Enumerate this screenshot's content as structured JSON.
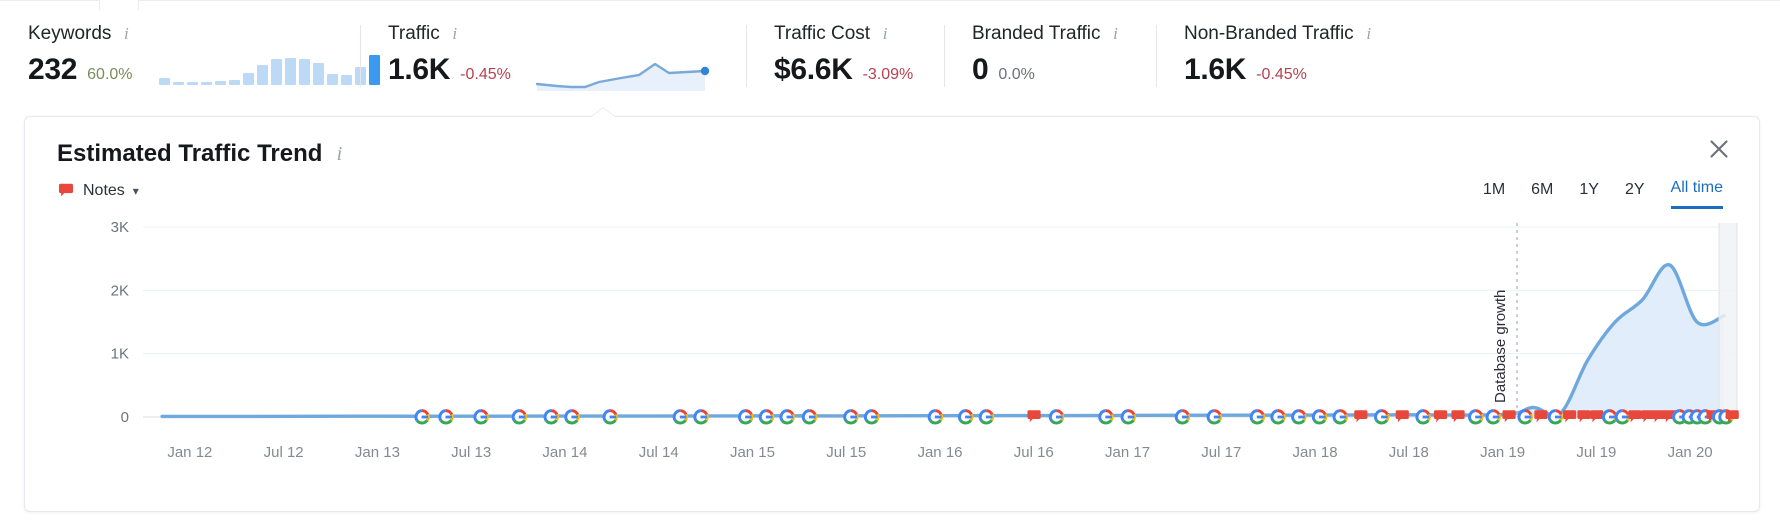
{
  "metrics": [
    {
      "label": "Keywords",
      "value": "232",
      "delta": "60.0%",
      "delta_kind": "pos",
      "info_icon": "info-icon",
      "sparkbars": [
        5,
        2,
        2,
        2,
        3,
        4,
        9,
        15,
        19,
        20,
        19,
        16,
        8,
        7,
        13,
        22
      ]
    },
    {
      "label": "Traffic",
      "value": "1.6K",
      "delta": "-0.45%",
      "delta_kind": "neg",
      "info_icon": "info-icon"
    },
    {
      "label": "Traffic Cost",
      "value": "$6.6K",
      "delta": "-3.09%",
      "delta_kind": "neg",
      "info_icon": "info-icon"
    },
    {
      "label": "Branded Traffic",
      "value": "0",
      "delta": "0.0%",
      "delta_kind": "zero",
      "info_icon": "info-icon"
    },
    {
      "label": "Non-Branded Traffic",
      "value": "1.6K",
      "delta": "-0.45%",
      "delta_kind": "neg",
      "info_icon": "info-icon"
    }
  ],
  "panel": {
    "title": "Estimated Traffic Trend",
    "info_icon": "info-icon",
    "notes_label": "Notes",
    "notes_icon": "note-bubble-icon",
    "chevron_icon": "chevron-down-icon",
    "close_icon": "close-icon",
    "ranges": [
      {
        "label": "1M",
        "active": false
      },
      {
        "label": "6M",
        "active": false
      },
      {
        "label": "1Y",
        "active": false
      },
      {
        "label": "2Y",
        "active": false
      },
      {
        "label": "All time",
        "active": true
      }
    ]
  },
  "colors": {
    "line": "#6fa8dc",
    "area": "#dfecfa",
    "accent": "#1c6ec0",
    "note_red": "#e8483c",
    "negative": "#b5414f",
    "positive": "#7a8c5c",
    "grid": "#eceff2"
  },
  "chart_data": {
    "type": "area",
    "title": "Estimated Traffic Trend",
    "xlabel": "",
    "ylabel": "",
    "ylim": [
      0,
      3000
    ],
    "yticks": [
      "0",
      "1K",
      "2K",
      "3K"
    ],
    "ytick_values": [
      0,
      1000,
      2000,
      3000
    ],
    "grid": true,
    "legend": "none",
    "xticks": [
      "Jan 12",
      "Jul 12",
      "Jan 13",
      "Jul 13",
      "Jan 14",
      "Jul 14",
      "Jan 15",
      "Jul 15",
      "Jan 16",
      "Jul 16",
      "Jan 17",
      "Jul 17",
      "Jan 18",
      "Jul 18",
      "Jan 19",
      "Jul 19",
      "Jan 20"
    ],
    "series": [
      {
        "name": "Estimated Traffic",
        "x": [
          "Jan 12",
          "Jul 12",
          "Jan 13",
          "Jul 13",
          "Jan 14",
          "Jul 14",
          "Jan 15",
          "Jul 15",
          "Jan 16",
          "Jul 16",
          "Jan 17",
          "Jul 17",
          "Jan 18",
          "Jul 18",
          "Jan 19",
          "Apr 19",
          "Jul 19",
          "Oct 19",
          "Nov 19",
          "Dec 19",
          "Jan 20",
          "Feb 20",
          "Mar 20"
        ],
        "values": [
          10,
          10,
          12,
          12,
          15,
          15,
          18,
          18,
          20,
          22,
          25,
          28,
          30,
          35,
          40,
          150,
          60,
          900,
          1500,
          1850,
          2400,
          1500,
          1600
        ]
      }
    ],
    "annotations": [
      {
        "label": "Database growth",
        "x": "Jul 19",
        "orientation": "vertical",
        "line_style": "dashed"
      }
    ],
    "markers": {
      "google_update_icon": "google-g-icon",
      "note_icon": "note-bubble-icon",
      "description": "Google algorithm update markers and red note markers along the zero baseline"
    }
  }
}
